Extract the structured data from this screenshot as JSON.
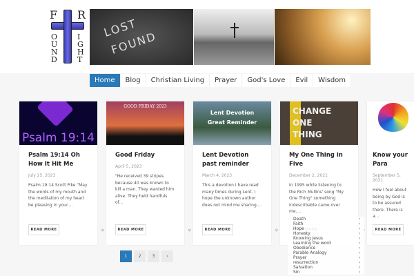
{
  "logo": {
    "text": "Found Right",
    "letters": [
      "F",
      "R",
      "O",
      "U",
      "N",
      "D",
      "I",
      "G",
      "H",
      "T"
    ]
  },
  "banner": {
    "lost": "LOST",
    "found": "FOUND"
  },
  "nav": [
    "Home",
    "Blog",
    "Christian Living",
    "Prayer",
    "God's Love",
    "Evil",
    "Wisdom"
  ],
  "posts": [
    {
      "title": "Psalm 19:14 Oh How It Hit Me",
      "date": "July 25, 2023",
      "excerpt": "Psalm 19:14 Scott Pike \"May the words of my mouth and the meditation of my heart be pleasing in your....",
      "img_text": "Psalm 19:14"
    },
    {
      "title": "Good Friday",
      "date": "April 5, 2023",
      "excerpt": "\"He received 39 stripes because 40 was known to kill a man. They wanted him alive. They held handfuls of...",
      "img_text": "GOOD FRIDAY 2023"
    },
    {
      "title": "Lent Devotion past reminder",
      "date": "March 4, 2023",
      "excerpt": "This a devotion I have read many times during Lent. I hope the unknown author does not mind me sharing....",
      "img_text": "Lent Devotion Great Reminder"
    },
    {
      "title": "My One Thing in Five",
      "date": "December 2, 2021",
      "excerpt": "In 1995 while listening to the Rich Mullins' song \"My One Thing\" something indescribable came over me....",
      "img_text": "CHANGE ONE THING"
    },
    {
      "title": "Know your Para",
      "date": "September 5, 2021",
      "excerpt": "How I feel about being by God is to be assured there. There is a...",
      "img_text": ""
    }
  ],
  "read_more": "READ MORE",
  "pagination": [
    "1",
    "2",
    "3",
    "›"
  ],
  "dropdown": [
    "Death",
    "Faith",
    "Hope",
    "Honesty",
    "Knowing Jesus",
    "Learning the word",
    "Obedience",
    "Parable Analogy",
    "Prayer",
    "resurrection",
    "Salvation",
    "Sin"
  ],
  "chevron": "›",
  "heart": "♥"
}
